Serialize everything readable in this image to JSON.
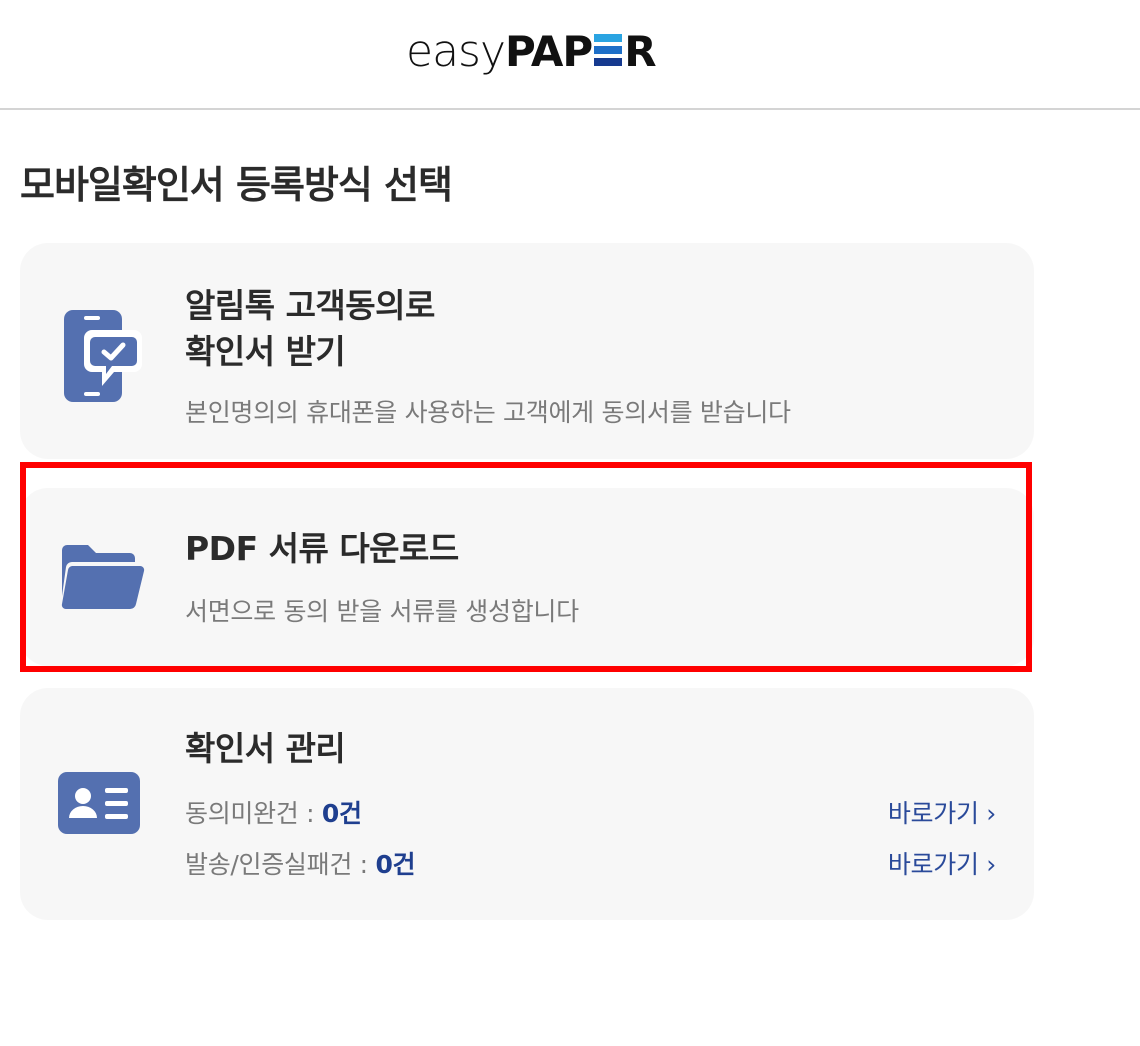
{
  "header": {
    "logo_easy": "easy",
    "logo_pap": "PAP",
    "logo_r": "R"
  },
  "page_title": "모바일확인서 등록방식 선택",
  "options": {
    "alimtalk": {
      "title_line1": "알림톡 고객동의로",
      "title_line2": "확인서 받기",
      "description": "본인명의의 휴대폰을 사용하는 고객에게 동의서를 받습니다",
      "icon": "phone-chat-check-icon"
    },
    "pdf": {
      "title": "PDF 서류 다운로드",
      "description": "서면으로 동의 받을 서류를 생성합니다",
      "icon": "folder-icon"
    },
    "manage": {
      "title": "확인서 관리",
      "icon": "id-card-icon",
      "rows": [
        {
          "label": "동의미완건 : ",
          "value": "0건",
          "link": "바로가기 ›"
        },
        {
          "label": "발송/인증실패건 : ",
          "value": "0건",
          "link": "바로가기 ›"
        }
      ]
    }
  },
  "colors": {
    "icon_blue": "#5470b0",
    "link_blue": "#2a4a9a",
    "highlight": "#ff0000",
    "card_bg": "#f7f7f7"
  }
}
